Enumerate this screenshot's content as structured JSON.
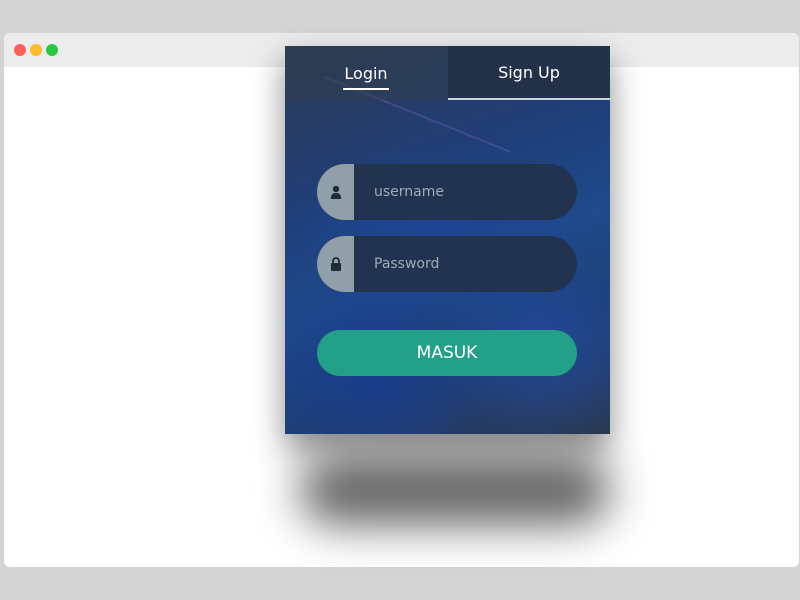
{
  "colors": {
    "accent": "#22a088",
    "card_dark": "#233248",
    "icon_bg": "#929fa8"
  },
  "tabs": [
    {
      "label": "Login",
      "active": true
    },
    {
      "label": "Sign Up",
      "active": false
    }
  ],
  "form": {
    "username": {
      "placeholder": "username",
      "value": "",
      "icon": "user-icon"
    },
    "password": {
      "placeholder": "Password",
      "value": "",
      "icon": "lock-icon"
    },
    "submit_label": "MASUK"
  }
}
